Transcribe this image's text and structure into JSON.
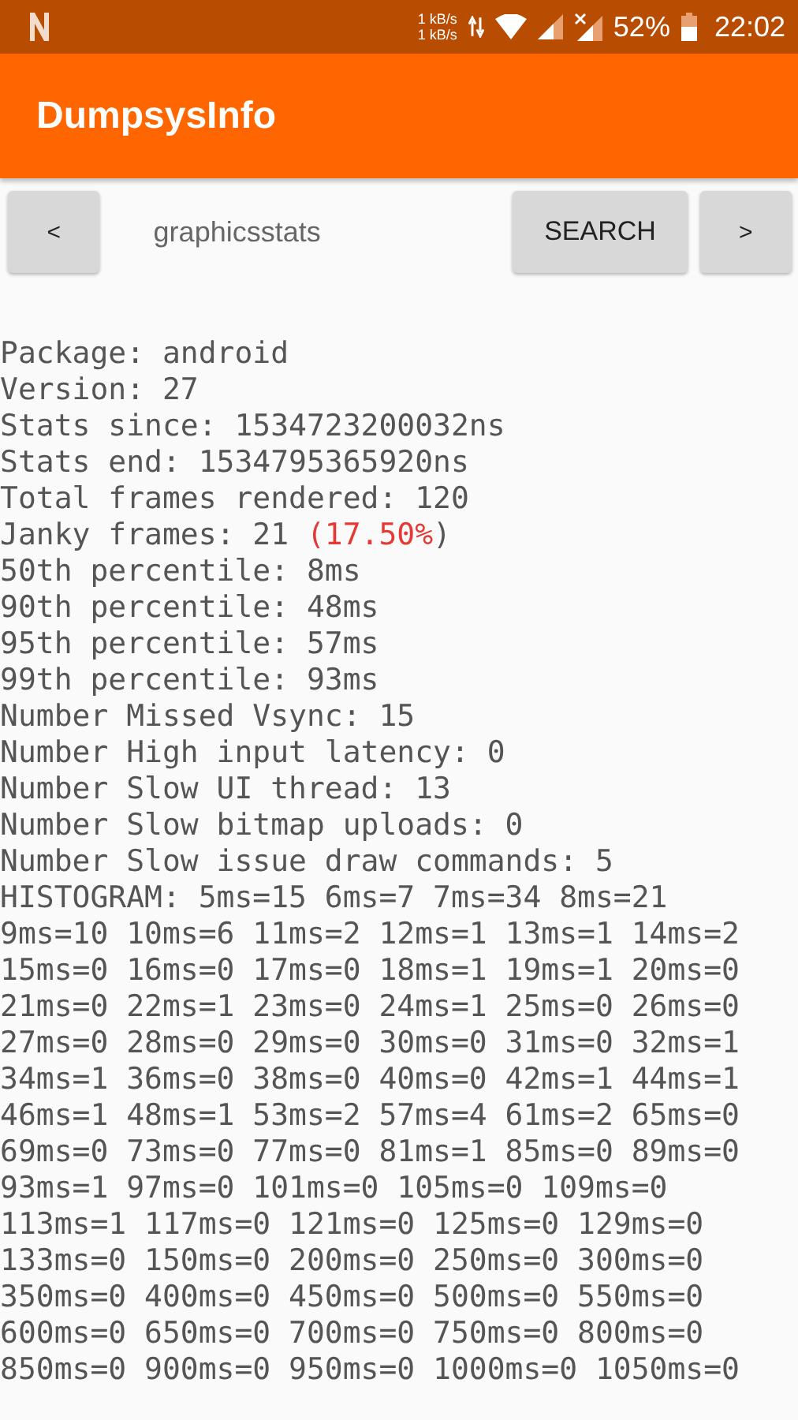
{
  "status_bar": {
    "speed_up": "1 kB/s",
    "speed_down": "1 kB/s",
    "battery": "52%",
    "time": "22:02"
  },
  "app_bar": {
    "title": "DumpsysInfo"
  },
  "toolbar": {
    "prev_button": "<",
    "search_field": {
      "value": "graphicsstats"
    },
    "search_button": "SEARCH",
    "next_button": ">"
  },
  "output": [
    {
      "text": "Package: android"
    },
    {
      "text": "Version: 27"
    },
    {
      "text": "Stats since: 1534723200032ns"
    },
    {
      "text": "Stats end: 1534795365920ns"
    },
    {
      "text": "Total frames rendered: 120"
    },
    {
      "text": "Janky frames: 21 ",
      "highlight": "(17.50%",
      "suffix": ")"
    },
    {
      "text": "50th percentile: 8ms"
    },
    {
      "text": "90th percentile: 48ms"
    },
    {
      "text": "95th percentile: 57ms"
    },
    {
      "text": "99th percentile: 93ms"
    },
    {
      "text": "Number Missed Vsync: 15"
    },
    {
      "text": "Number High input latency: 0"
    },
    {
      "text": "Number Slow UI thread: 13"
    },
    {
      "text": "Number Slow bitmap uploads: 0"
    },
    {
      "text": "Number Slow issue draw commands: 5"
    },
    {
      "text": "HISTOGRAM: 5ms=15 6ms=7 7ms=34 8ms=21"
    },
    {
      "text": "9ms=10 10ms=6 11ms=2 12ms=1 13ms=1 14ms=2"
    },
    {
      "text": "15ms=0 16ms=0 17ms=0 18ms=1 19ms=1 20ms=0"
    },
    {
      "text": "21ms=0 22ms=1 23ms=0 24ms=1 25ms=0 26ms=0"
    },
    {
      "text": "27ms=0 28ms=0 29ms=0 30ms=0 31ms=0 32ms=1"
    },
    {
      "text": "34ms=1 36ms=0 38ms=0 40ms=0 42ms=1 44ms=1"
    },
    {
      "text": "46ms=1 48ms=1 53ms=2 57ms=4 61ms=2 65ms=0"
    },
    {
      "text": "69ms=0 73ms=0 77ms=0 81ms=1 85ms=0 89ms=0"
    },
    {
      "text": "93ms=1 97ms=0 101ms=0 105ms=0 109ms=0"
    },
    {
      "text": "113ms=1 117ms=0 121ms=0 125ms=0 129ms=0"
    },
    {
      "text": "133ms=0 150ms=0 200ms=0 250ms=0 300ms=0"
    },
    {
      "text": "350ms=0 400ms=0 450ms=0 500ms=0 550ms=0"
    },
    {
      "text": "600ms=0 650ms=0 700ms=0 750ms=0 800ms=0"
    },
    {
      "text": "850ms=0 900ms=0 950ms=0 1000ms=0 1050ms=0"
    }
  ]
}
